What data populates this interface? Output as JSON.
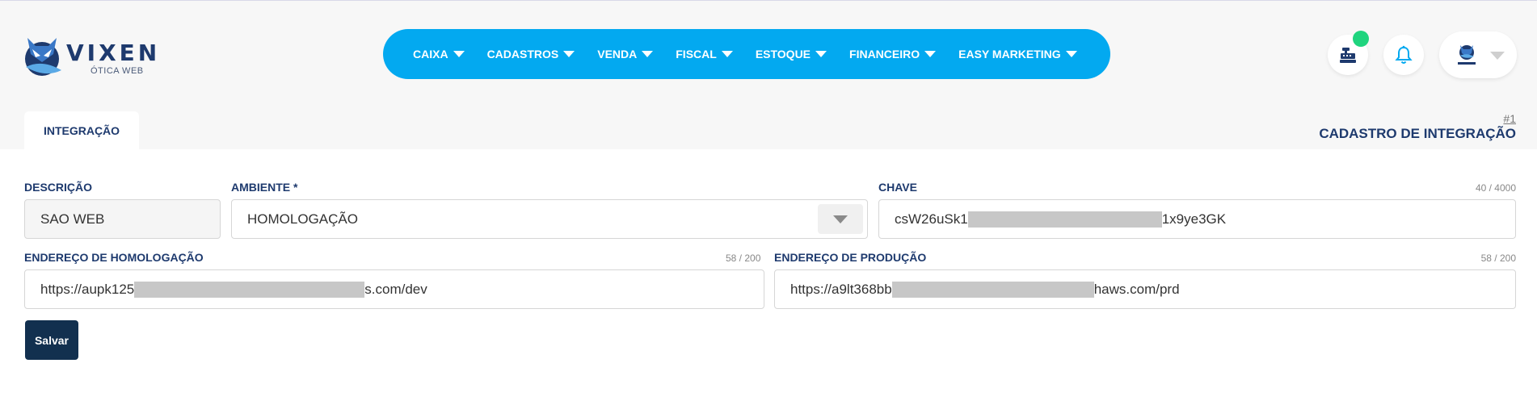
{
  "brand": {
    "name": "VIXEN",
    "subtitle": "ÓTICA WEB"
  },
  "nav": {
    "items": [
      {
        "label": "CAIXA"
      },
      {
        "label": "CADASTROS"
      },
      {
        "label": "VENDA"
      },
      {
        "label": "FISCAL"
      },
      {
        "label": "ESTOQUE"
      },
      {
        "label": "FINANCEIRO"
      },
      {
        "label": "EASY MARKETING"
      }
    ]
  },
  "header_right": {
    "register_icon": "cash-register-icon",
    "bell_icon": "bell-icon",
    "status_color": "#1fd47e"
  },
  "tab": {
    "label": "INTEGRAÇÃO"
  },
  "page": {
    "record_number": "#1",
    "title": "CADASTRO DE INTEGRAÇÃO"
  },
  "form": {
    "descricao": {
      "label": "DESCRIÇÃO",
      "value": "SAO WEB"
    },
    "ambiente": {
      "label": "AMBIENTE *",
      "value": "HOMOLOGAÇÃO"
    },
    "chave": {
      "label": "CHAVE",
      "counter": "40 / 4000",
      "value_start": "csW26uSk1",
      "value_end": "1x9ye3GK"
    },
    "endereco_homologacao": {
      "label": "ENDEREÇO DE HOMOLOGAÇÃO",
      "counter": "58 / 200",
      "value_start": "https://aupk125",
      "value_end": "s.com/dev"
    },
    "endereco_producao": {
      "label": "ENDEREÇO DE PRODUÇÃO",
      "counter": "58 / 200",
      "value_start": "https://a9lt368bb",
      "value_end": "haws.com/prd"
    },
    "save_label": "Salvar"
  },
  "colors": {
    "accent": "#03a9f0",
    "heading": "#1e3a6e",
    "button": "#12304f"
  }
}
